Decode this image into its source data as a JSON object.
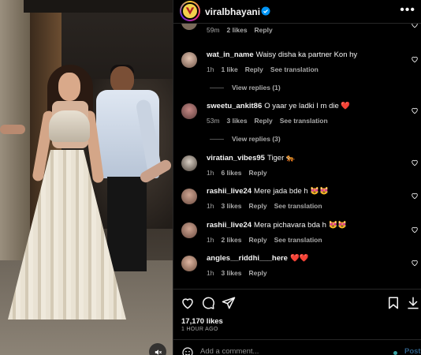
{
  "header": {
    "username": "viralbhayani",
    "verified_icon": "verified-badge-icon",
    "more_icon": "more-options-icon"
  },
  "comments": [
    {
      "id": "c0",
      "username": "",
      "text": "",
      "time": "59m",
      "likes": "2 likes",
      "reply": "Reply",
      "translation": ""
    },
    {
      "id": "c1",
      "username": "wat_in_name",
      "text": "Waisy disha ka partner Kon hy",
      "time": "1h",
      "likes": "1 like",
      "reply": "Reply",
      "translation": "See translation",
      "view_replies": "View replies (1)"
    },
    {
      "id": "c2",
      "username": "sweetu_ankit86",
      "text": "O yaar ye ladki I m die ❤️",
      "time": "53m",
      "likes": "3 likes",
      "reply": "Reply",
      "translation": "See translation",
      "view_replies": "View replies (3)"
    },
    {
      "id": "c3",
      "username": "viratian_vibes95",
      "text": "Tiger 🐅",
      "time": "1h",
      "likes": "6 likes",
      "reply": "Reply",
      "translation": ""
    },
    {
      "id": "c4",
      "username": "rashii_live24",
      "text": "Mere jada bde h 😻😻",
      "time": "1h",
      "likes": "3 likes",
      "reply": "Reply",
      "translation": "See translation"
    },
    {
      "id": "c5",
      "username": "rashii_live24",
      "text": "Mera pichavara bda h 😻😻",
      "time": "1h",
      "likes": "2 likes",
      "reply": "Reply",
      "translation": "See translation"
    },
    {
      "id": "c6",
      "username": "angles__riddhi___here",
      "text": "❤️❤️",
      "time": "1h",
      "likes": "3 likes",
      "reply": "Reply",
      "translation": ""
    }
  ],
  "post": {
    "likes_count": "17,170 likes",
    "time_ago": "1 HOUR AGO"
  },
  "add_comment": {
    "placeholder": "Add a comment...",
    "post_label": "Post"
  },
  "colors": {
    "background": "#000000",
    "muted_text": "#a8a8a8",
    "divider": "#262626",
    "heart_red": "#ff3040",
    "post_button": "#2f5f86"
  }
}
